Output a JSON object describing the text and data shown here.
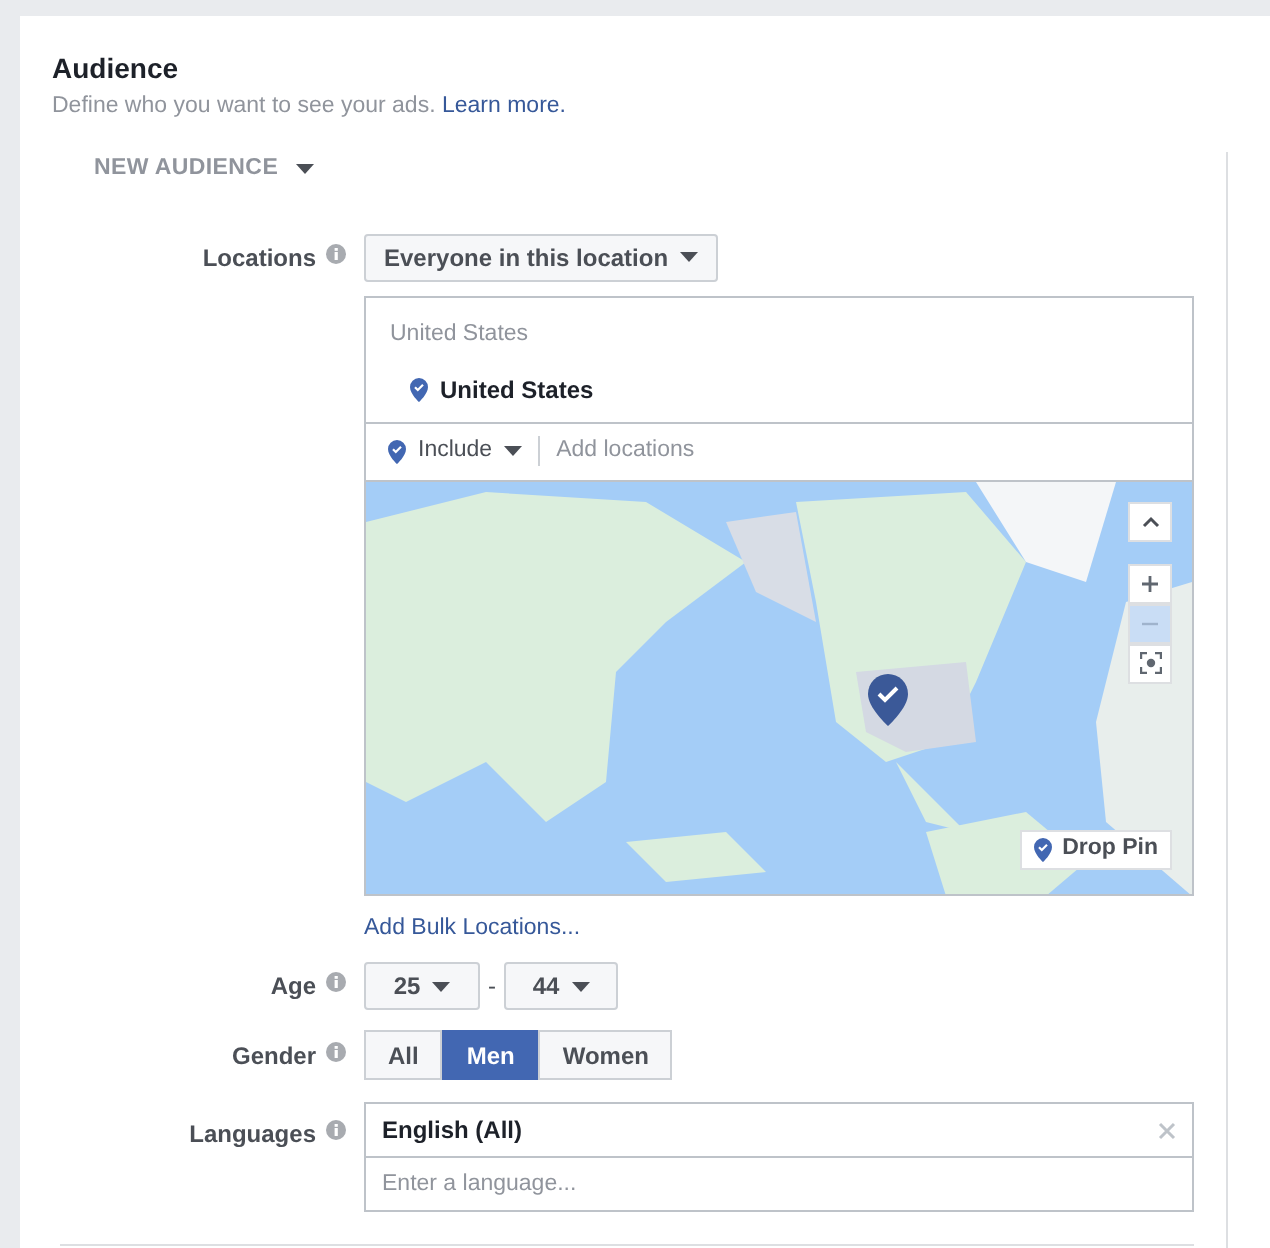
{
  "section": {
    "title": "Audience",
    "description": "Define who you want to see your ads.",
    "link": "Learn more."
  },
  "audience_menu": {
    "label": "NEW AUDIENCE"
  },
  "locations": {
    "label": "Locations",
    "mode": "Everyone in this location",
    "group_heading": "United States",
    "selected_location": "United States",
    "include": "Include",
    "placeholder": "Add locations",
    "drop_pin": "Drop Pin",
    "bulk_link": "Add Bulk Locations..."
  },
  "age": {
    "label": "Age",
    "min": "25",
    "separator": "-",
    "max": "44"
  },
  "gender": {
    "label": "Gender",
    "options": [
      {
        "label": "All",
        "selected": false
      },
      {
        "label": "Men",
        "selected": true
      },
      {
        "label": "Women",
        "selected": false
      }
    ]
  },
  "languages": {
    "label": "Languages",
    "tags": [
      "English (All)"
    ],
    "placeholder": "Enter a language..."
  }
}
